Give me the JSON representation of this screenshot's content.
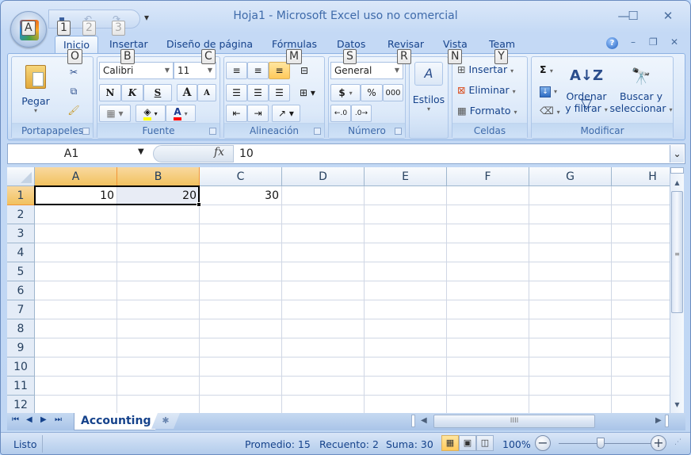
{
  "window": {
    "title": "Hoja1 - Microsoft Excel uso no comercial",
    "controls": {
      "minimize": "—",
      "maximize": "☐",
      "close": "✕"
    },
    "mdi_controls": {
      "help": "?",
      "minimize": "–",
      "restore": "❐",
      "close": "✕"
    }
  },
  "office_button": {
    "keytip": "A"
  },
  "quick_access": {
    "items": [
      {
        "name": "save",
        "glyph": "▪",
        "keytip": "1"
      },
      {
        "name": "undo",
        "glyph": "↶",
        "keytip": "2"
      },
      {
        "name": "redo",
        "glyph": "↷",
        "keytip": "3"
      }
    ],
    "customize_glyph": "▾"
  },
  "ribbon_tabs": [
    {
      "label": "Inicio",
      "keytip": "O",
      "active": true
    },
    {
      "label": "Insertar",
      "keytip": "B"
    },
    {
      "label": "Diseño de página",
      "keytip": "C"
    },
    {
      "label": "Fórmulas",
      "keytip": "M"
    },
    {
      "label": "Datos",
      "keytip": "S"
    },
    {
      "label": "Revisar",
      "keytip": "R"
    },
    {
      "label": "Vista",
      "keytip": "N"
    },
    {
      "label": "Team",
      "keytip": "Y"
    }
  ],
  "groups": {
    "clipboard": {
      "label": "Portapapeles",
      "paste": "Pegar"
    },
    "font": {
      "label": "Fuente",
      "font_name": "Calibri",
      "font_size": "11",
      "bold": "N",
      "italic": "K",
      "underline": "S",
      "grow": "A",
      "shrink": "A",
      "fill_color": "#ffff00",
      "font_color": "#ff0000"
    },
    "alignment": {
      "label": "Alineación"
    },
    "number": {
      "label": "Número",
      "format": "General",
      "currency": "$",
      "percent": "%",
      "thousands": "000"
    },
    "styles": {
      "label": "Estilos"
    },
    "cells": {
      "label": "Celdas",
      "insert": "Insertar",
      "delete": "Eliminar",
      "format": "Formato"
    },
    "editing": {
      "label": "Modificar",
      "sum": "Σ",
      "sort": "Ordenar\ny filtrar",
      "sort_l1": "Ordenar",
      "sort_l2": "y filtrar",
      "find_l1": "Buscar y",
      "find_l2": "seleccionar"
    }
  },
  "formula_bar": {
    "name_box": "A1",
    "fx": "fx",
    "value": "10",
    "expand": "⌄"
  },
  "sheet": {
    "columns": [
      "A",
      "B",
      "C",
      "D",
      "E",
      "F",
      "G",
      "H"
    ],
    "rows": [
      "1",
      "2",
      "3",
      "4",
      "5",
      "6",
      "7",
      "8",
      "9",
      "10",
      "11",
      "12"
    ],
    "cells": {
      "A1": "10",
      "B1": "20",
      "C1": "30"
    },
    "selected_range": "A1:B1",
    "active_cell": "A1"
  },
  "sheet_tabs": {
    "tabs": [
      "Accounting"
    ],
    "active": "Accounting"
  },
  "status": {
    "mode": "Listo",
    "average": "Promedio: 15",
    "count": "Recuento: 2",
    "sum": "Suma: 30",
    "zoom": "100%"
  }
}
